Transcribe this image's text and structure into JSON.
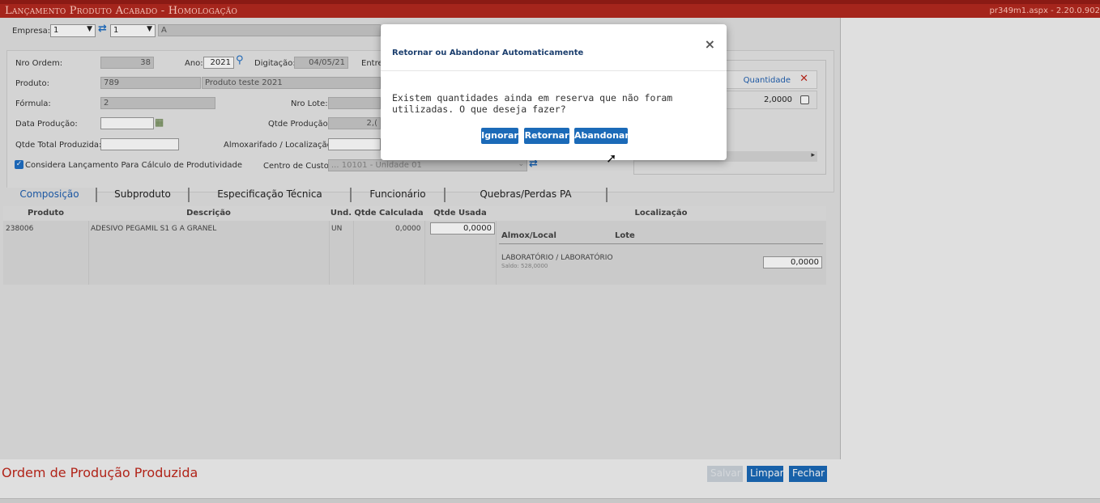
{
  "window": {
    "title": "Lançamento Produto Acabado  - Homologação",
    "version": "pr349m1.aspx - 2.20.0.902"
  },
  "header": {
    "empresa_label": "Empresa:",
    "empresa_value": "1",
    "filial_value": "1",
    "empresa_name": "A"
  },
  "form": {
    "nro_ordem_label": "Nro Ordem:",
    "nro_ordem": "38",
    "ano_label": "Ano:",
    "ano": "2021",
    "digitacao_label": "Digitação:",
    "digitacao": "04/05/21",
    "entrega_label": "Entre",
    "produto_label": "Produto:",
    "produto_code": "789",
    "produto_name": "Produto teste 2021",
    "formula_label": "Fórmula:",
    "formula": "2",
    "nro_lote_label": "Nro Lote:",
    "data_producao_label": "Data Produção:",
    "qtde_producao_label": "Qtde Produção:",
    "qtde_producao": "2,(",
    "qtde_total_label": "Qtde Total Produzida:",
    "almox_label": "Almoxarifado / Localização:",
    "considera_label": "Considera Lançamento Para Cálculo de Produtividade",
    "centro_custo_label": "Centro de Custo:",
    "centro_custo": "... 10101 - Unidade 01"
  },
  "right_panel": {
    "col_quantidade": "Quantidade",
    "quantidade": "2,0000"
  },
  "tabs": [
    "Composição",
    "Subproduto",
    "Especificação Técnica",
    "Funcionário",
    "Quebras/Perdas PA"
  ],
  "grid": {
    "headers": [
      "Produto",
      "Descrição",
      "Und.",
      "Qtde Calculada",
      "Qtde Usada",
      "Localização"
    ],
    "row": {
      "produto": "238006",
      "descricao": "ADESIVO PEGAMIL S1 G A GRANEL",
      "und": "UN",
      "qtde_calculada": "0,0000",
      "qtde_usada": "0,0000"
    },
    "sub_headers": [
      "Almox/Local",
      "Lote"
    ],
    "location": "LABORATÓRIO / LABORATÓRIO",
    "saldo": "Saldo: 528,0000",
    "location_qty": "0,0000"
  },
  "footer": {
    "status": "Ordem de Produção Produzida",
    "salvar": "Salvar",
    "limpar": "Limpar",
    "fechar": "Fechar"
  },
  "modal": {
    "title": "Retornar ou Abandonar Automaticamente",
    "close": "×",
    "message": "Existem quantidades ainda em reserva que não foram utilizadas. O que deseja fazer?",
    "btn_ignorar": "Ignorar",
    "btn_retornar": "Retornar",
    "btn_abandonar": "Abandonar"
  },
  "colors": {
    "titlebar": "#a5251c",
    "accent": "#1b6ab8",
    "status": "#c0281c"
  }
}
